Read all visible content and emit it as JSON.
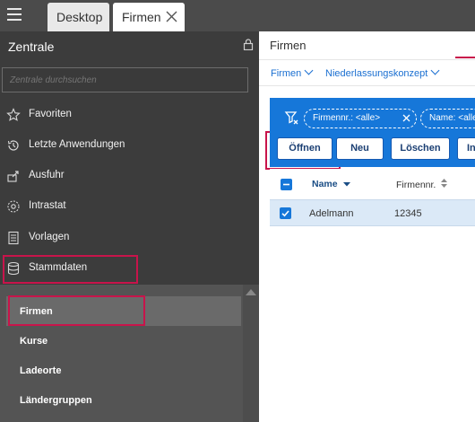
{
  "tabs": [
    {
      "label": "Desktop"
    },
    {
      "label": "Firmen",
      "active": true
    }
  ],
  "sidebar": {
    "title": "Zentrale",
    "search_placeholder": "Zentrale durchsuchen",
    "items": [
      {
        "label": "Favoriten",
        "icon": "star-icon"
      },
      {
        "label": "Letzte Anwendungen",
        "icon": "history-icon"
      },
      {
        "label": "Ausfuhr",
        "icon": "export-icon"
      },
      {
        "label": "Intrastat",
        "icon": "globe-icon"
      },
      {
        "label": "Vorlagen",
        "icon": "document-icon"
      },
      {
        "label": "Stammdaten",
        "icon": "database-icon"
      }
    ],
    "sub_items": [
      {
        "label": "Firmen",
        "active": true
      },
      {
        "label": "Kurse"
      },
      {
        "label": "Ladeorte"
      },
      {
        "label": "Ländergruppen"
      }
    ]
  },
  "main": {
    "title": "Firmen",
    "breadcrumbs": [
      "Firmen",
      "Niederlassungskonzept"
    ],
    "filters": [
      {
        "label": "Firmennr.: <alle>"
      },
      {
        "label": "Name: <alle"
      }
    ],
    "buttons": [
      "Öffnen",
      "Neu",
      "Löschen",
      "In"
    ],
    "table": {
      "columns": [
        "Name",
        "Firmennr."
      ],
      "rows": [
        {
          "name": "Adelmann",
          "firmennr": "12345",
          "checked": true
        }
      ]
    }
  },
  "colors": {
    "accent": "#1677d9",
    "highlight": "#c8144b",
    "sidebar_bg": "#3c3c3c"
  }
}
